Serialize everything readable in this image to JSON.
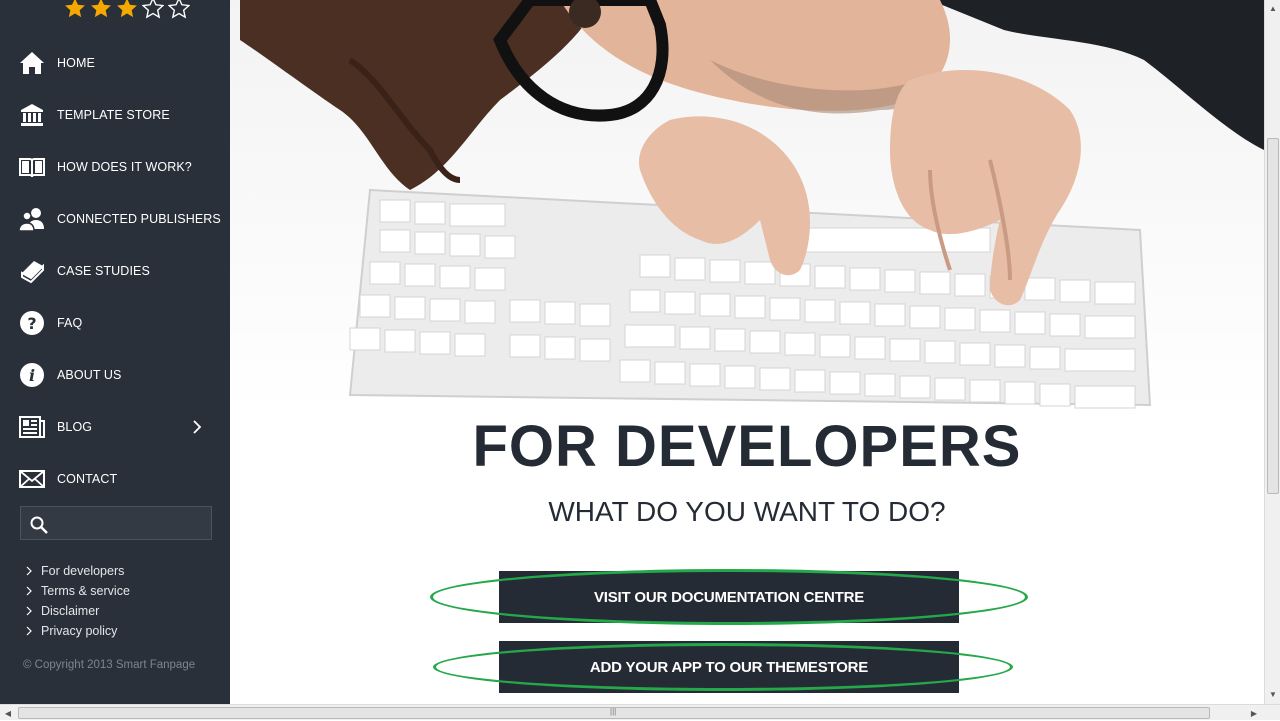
{
  "sidebar": {
    "rating": {
      "value": 3,
      "max": 5
    },
    "nav": [
      {
        "label": "HOME",
        "icon": "home-icon"
      },
      {
        "label": "TEMPLATE STORE",
        "icon": "bank-icon"
      },
      {
        "label": "HOW DOES IT WORK?",
        "icon": "book-icon"
      },
      {
        "label": "CONNECTED PUBLISHERS",
        "icon": "users-icon"
      },
      {
        "label": "CASE STUDIES",
        "icon": "notebook-icon"
      },
      {
        "label": "FAQ",
        "icon": "question-icon"
      },
      {
        "label": "ABOUT US",
        "icon": "info-icon"
      },
      {
        "label": "BLOG",
        "icon": "newspaper-icon",
        "has_submenu": true
      },
      {
        "label": "CONTACT",
        "icon": "envelope-icon"
      }
    ],
    "search": {
      "placeholder": ""
    },
    "footer_links": [
      "For developers",
      "Terms & service",
      "Disclaimer",
      "Privacy policy"
    ],
    "copyright": "© Copyright 2013 Smart Fanpage"
  },
  "main": {
    "hero_image": "developer-at-keyboard",
    "headline": "FOR DEVELOPERS",
    "subheadline": "WHAT DO YOU WANT TO DO?",
    "buttons": [
      {
        "label": "VISIT OUR DOCUMENTATION CENTRE"
      },
      {
        "label": "ADD YOUR APP TO OUR THEMESTORE"
      }
    ]
  },
  "colors": {
    "sidebar_bg": "#2a3039",
    "button_bg": "#252b34",
    "star": "#f5a800",
    "highlight_ring": "#24a84a"
  }
}
